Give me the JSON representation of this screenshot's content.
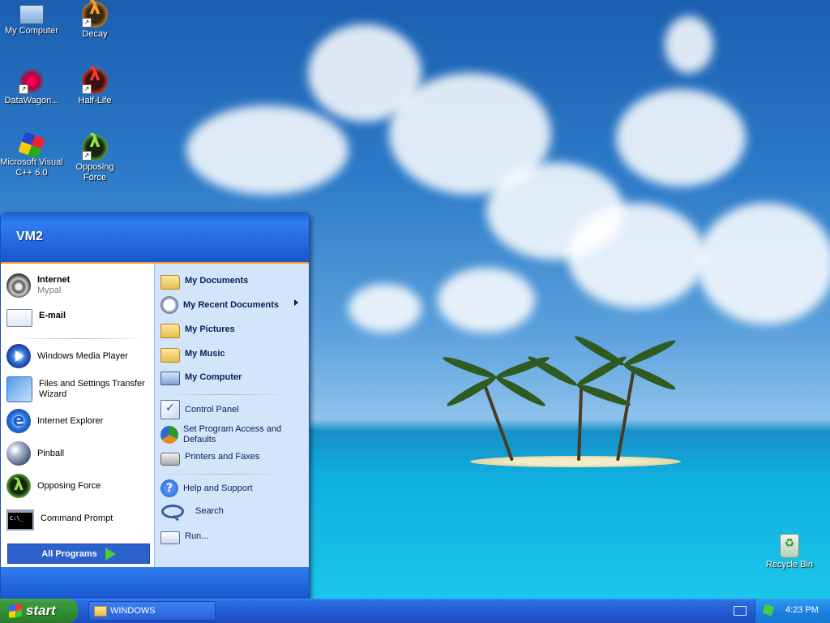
{
  "desktop": {
    "icons": [
      {
        "label": "My Computer"
      },
      {
        "label": "Decay"
      },
      {
        "label": "DataWagon..."
      },
      {
        "label": "Half-Life"
      },
      {
        "label": "Microsoft Visual C++ 6.0"
      },
      {
        "label": "Opposing Force"
      },
      {
        "label": "Recycle Bin"
      }
    ]
  },
  "start_menu": {
    "user": "VM2",
    "left_pinned": [
      {
        "title": "Internet",
        "subtitle": "Mypal",
        "icon": "raccoon-icon"
      },
      {
        "title": "E-mail",
        "icon": "mail-icon"
      }
    ],
    "left_recent": [
      {
        "label": "Windows Media Player",
        "icon": "media-player-icon"
      },
      {
        "label": "Files and Settings Transfer Wizard",
        "icon": "transfer-wizard-icon"
      },
      {
        "label": "Internet Explorer",
        "icon": "ie-icon"
      },
      {
        "label": "Pinball",
        "icon": "pinball-icon"
      },
      {
        "label": "Opposing Force",
        "icon": "half-life-icon"
      },
      {
        "label": "Command Prompt",
        "icon": "cmd-icon"
      }
    ],
    "all_programs": "All Programs",
    "right_places": [
      {
        "label": "My Documents"
      },
      {
        "label": "My Recent Documents"
      },
      {
        "label": "My Pictures"
      },
      {
        "label": "My Music"
      },
      {
        "label": "My Computer"
      }
    ],
    "right_settings": [
      {
        "label": "Control Panel"
      },
      {
        "label": "Set Program Access and Defaults"
      },
      {
        "label": "Printers and Faxes"
      }
    ],
    "right_help": [
      {
        "label": "Help and Support"
      },
      {
        "label": "Search"
      },
      {
        "label": "Run..."
      }
    ]
  },
  "taskbar": {
    "start_label": "start",
    "task_item": "WINDOWS",
    "clock": "4:23 PM"
  },
  "colors": {
    "taskbar_blue": "#2459d1",
    "start_green": "#3c9a3c",
    "menu_header_blue": "#1e63d6",
    "accent_orange": "#f39b27"
  }
}
